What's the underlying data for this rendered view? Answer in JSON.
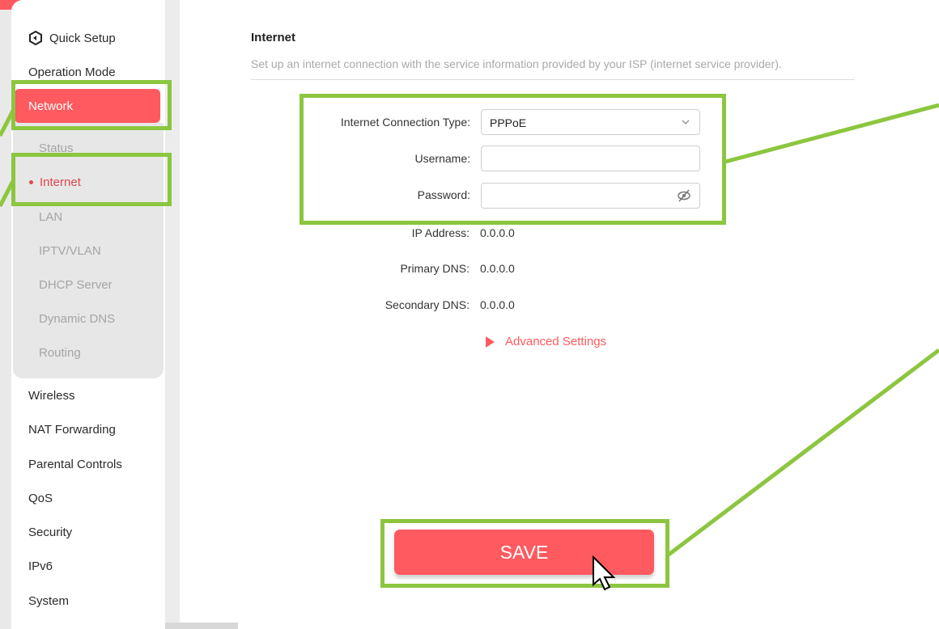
{
  "sidebar": {
    "quick_setup": "Quick Setup",
    "operation_mode": "Operation Mode",
    "network": "Network",
    "sub_items": [
      "Status",
      "Internet",
      "LAN",
      "IPTV/VLAN",
      "DHCP Server",
      "Dynamic DNS",
      "Routing"
    ],
    "items": [
      "Wireless",
      "NAT Forwarding",
      "Parental Controls",
      "QoS",
      "Security",
      "IPv6",
      "System"
    ]
  },
  "main": {
    "title": "Internet",
    "description": "Set up an internet connection with the service information provided by your ISP (internet service provider).",
    "connection_type_label": "Internet Connection Type:",
    "connection_type_value": "PPPoE",
    "username_label": "Username:",
    "username_value": "",
    "password_label": "Password:",
    "password_value": "",
    "ip_label": "IP Address:",
    "ip_value": "0.0.0.0",
    "primary_dns_label": "Primary DNS:",
    "primary_dns_value": "0.0.0.0",
    "secondary_dns_label": "Secondary DNS:",
    "secondary_dns_value": "0.0.0.0",
    "advanced_settings": "Advanced Settings",
    "save": "SAVE"
  },
  "colors": {
    "accent": "#ff5a5f",
    "highlight": "#8cc63f"
  },
  "icons": [
    "gear-icon",
    "chevron-down-icon",
    "eye-off-icon",
    "triangle-right-icon",
    "cursor-icon"
  ]
}
